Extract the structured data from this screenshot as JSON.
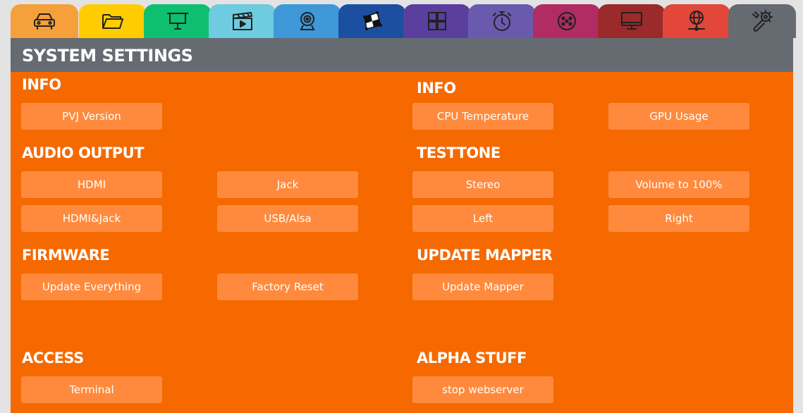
{
  "tabs": [
    {
      "icon": "car-icon",
      "color": "#f5a03a"
    },
    {
      "icon": "folder-icon",
      "color": "#ffcc00"
    },
    {
      "icon": "projector-screen-icon",
      "color": "#0dbf6f"
    },
    {
      "icon": "clapperboard-icon",
      "color": "#6ecbe0"
    },
    {
      "icon": "webcam-icon",
      "color": "#3f98d8"
    },
    {
      "icon": "mapping-grid-icon",
      "color": "#1d4fa0"
    },
    {
      "icon": "grid-icon",
      "color": "#5a3f9f"
    },
    {
      "icon": "timer-icon",
      "color": "#6a5aad"
    },
    {
      "icon": "dmx-connector-icon",
      "color": "#b02c62"
    },
    {
      "icon": "monitor-icon",
      "color": "#9b2a2a"
    },
    {
      "icon": "network-icon",
      "color": "#e2473a"
    },
    {
      "icon": "wrench-gear-icon",
      "color": "#666b72"
    }
  ],
  "panel": {
    "title": "SYSTEM SETTINGS"
  },
  "sections": {
    "info_left": {
      "title": "INFO",
      "buttons": [
        "PVJ Version"
      ]
    },
    "info_right": {
      "title": "INFO",
      "buttons": [
        "CPU Temperature",
        "GPU Usage"
      ]
    },
    "audio_output": {
      "title": "AUDIO OUTPUT",
      "buttons": [
        "HDMI",
        "Jack",
        "HDMI&Jack",
        "USB/Alsa"
      ]
    },
    "testtone": {
      "title": "TESTTONE",
      "buttons": [
        "Stereo",
        "Volume to 100%",
        "Left",
        "Right"
      ]
    },
    "firmware": {
      "title": "FIRMWARE",
      "buttons": [
        "Update Everything",
        "Factory Reset"
      ]
    },
    "update_mapper": {
      "title": "UPDATE MAPPER",
      "buttons": [
        "Update Mapper"
      ]
    },
    "access": {
      "title": "ACCESS",
      "buttons": [
        "Terminal"
      ]
    },
    "alpha_stuff": {
      "title": "ALPHA STUFF",
      "buttons": [
        "stop webserver"
      ]
    }
  }
}
